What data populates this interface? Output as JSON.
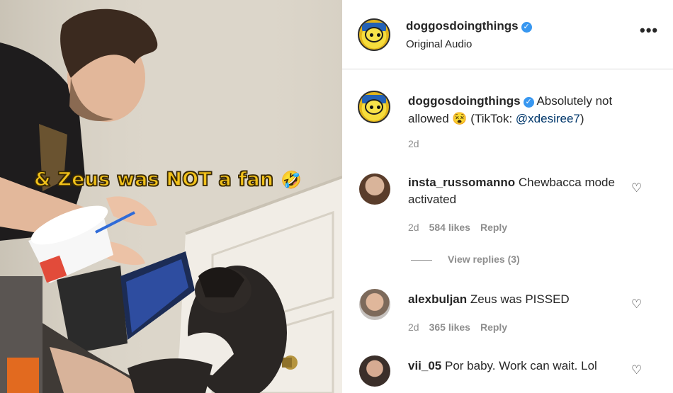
{
  "video": {
    "caption_text": "& Zeus was NOT a fan",
    "caption_emoji": "🤣"
  },
  "header": {
    "username": "doggosdoingthings",
    "verified_glyph": "✓",
    "audio": "Original Audio",
    "more_glyph": "•••"
  },
  "caption": {
    "username": "doggosdoingthings",
    "verified_glyph": "✓",
    "text_before": "Absolutely not allowed",
    "emoji": "😵",
    "text_mid": "(TikTok:",
    "mention": "@xdesiree7",
    "text_after": ")",
    "time": "2d"
  },
  "comments": [
    {
      "username": "insta_russomanno",
      "text": "Chewbacca mode activated",
      "time": "2d",
      "likes": "584 likes",
      "reply": "Reply",
      "heart_glyph": "♡"
    },
    {
      "username": "alexbuljan",
      "text": "Zeus was PISSED",
      "time": "2d",
      "likes": "365 likes",
      "reply": "Reply",
      "heart_glyph": "♡"
    },
    {
      "username": "vii_05",
      "text": "Por baby. Work can wait. Lol",
      "heart_glyph": "♡"
    }
  ],
  "view_replies": "View replies (3)",
  "icons": [
    "verified-badge-icon",
    "more-options-icon",
    "heart-icon"
  ],
  "colors": {
    "verified": "#3897f0",
    "mention": "#00376b",
    "muted": "#8e8e8e",
    "caption_yellow": "#f2c21a"
  }
}
